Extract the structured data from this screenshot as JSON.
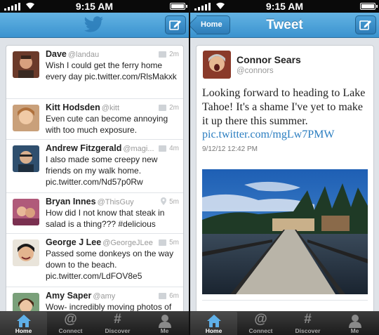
{
  "status_bar": {
    "time": "9:15 AM"
  },
  "left": {
    "tweets": [
      {
        "name": "Dave",
        "handle": "@landau",
        "time": "2m",
        "text": "Wish I could get the ferry home every day pic.twitter.com/RlsMakxk",
        "icon": "photo-icon"
      },
      {
        "name": "Kitt Hodsden",
        "handle": "@kitt",
        "time": "2m",
        "text": "Even cute can become annoying with too much exposure.",
        "icon": "photo-icon"
      },
      {
        "name": "Andrew Fitzgerald",
        "handle": "@magi...",
        "time": "4m",
        "text": "I also made some creepy new friends on my walk home. pic.twitter.com/Nd57p0Rw",
        "icon": "photo-icon"
      },
      {
        "name": "Bryan Innes",
        "handle": "@ThisGuy",
        "time": "5m",
        "text": "How did I not know that steak in salad is a thing??? #delicious",
        "icon": "location-pin-icon"
      },
      {
        "name": "George J Lee",
        "handle": "@GeorgeJLee",
        "time": "5m",
        "text": "Passed some donkeys on the way down to the beach. pic.twitter.com/LdFOV8e5",
        "icon": "photo-icon"
      },
      {
        "name": "Amy Saper",
        "handle": "@amy",
        "time": "6m",
        "text": "Wow- incredibly moving photos of",
        "icon": "photo-icon"
      }
    ]
  },
  "right": {
    "nav": {
      "back_label": "Home",
      "title": "Tweet"
    },
    "detail": {
      "name": "Connor Sears",
      "handle": "@connors",
      "text": "Looking forward to heading to Lake Tahoe! It's a shame I've yet to make it up there this summer.",
      "link": "pic.twitter.com/mgLw7PMW",
      "timestamp": "9/12/12 12:42 PM"
    }
  },
  "tabs": [
    {
      "label": "Home",
      "icon": "house-icon",
      "active": true
    },
    {
      "label": "Connect",
      "icon": "at-sign-icon",
      "active": false
    },
    {
      "label": "Discover",
      "icon": "hashtag-icon",
      "active": false
    },
    {
      "label": "Me",
      "icon": "person-icon",
      "active": false
    }
  ],
  "colors": {
    "nav_blue": "#4aa3dc",
    "link_blue": "#2a7dc0",
    "tabbar": "#222222"
  }
}
